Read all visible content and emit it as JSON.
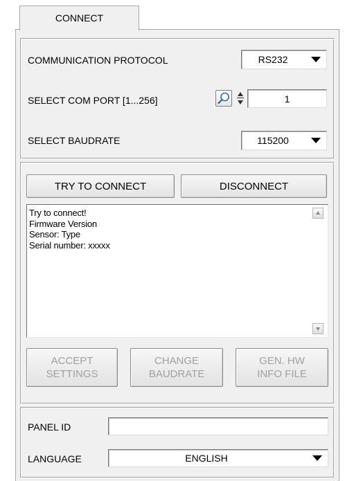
{
  "tab": {
    "label": "CONNECT"
  },
  "connection": {
    "protocol_label": "COMMUNICATION PROTOCOL",
    "protocol_value": "RS232",
    "comport_label": "SELECT COM PORT [1...256]",
    "comport_value": "1",
    "baudrate_label": "SELECT BAUDRATE",
    "baudrate_value": "115200"
  },
  "actions": {
    "try_connect": "TRY TO CONNECT",
    "disconnect": "DISCONNECT",
    "log_lines": [
      "Try to connect!",
      "Firmware Version",
      "Sensor: Type",
      "Serial number: xxxxx"
    ],
    "accept_settings": "ACCEPT\nSETTINGS",
    "change_baudrate": "CHANGE\nBAUDRATE",
    "gen_hw_info": "GEN. HW\nINFO FILE"
  },
  "panel": {
    "panel_id_label": "PANEL ID",
    "panel_id_value": "",
    "language_label": "LANGUAGE",
    "language_value": "ENGLISH"
  },
  "icons": {
    "search": "magnifier-icon",
    "spinner": "spinner-icon",
    "dropdown": "chevron-down-icon"
  },
  "colors": {
    "panel_bg": "#f0f0f0",
    "disabled_text": "#a0a0a0"
  }
}
